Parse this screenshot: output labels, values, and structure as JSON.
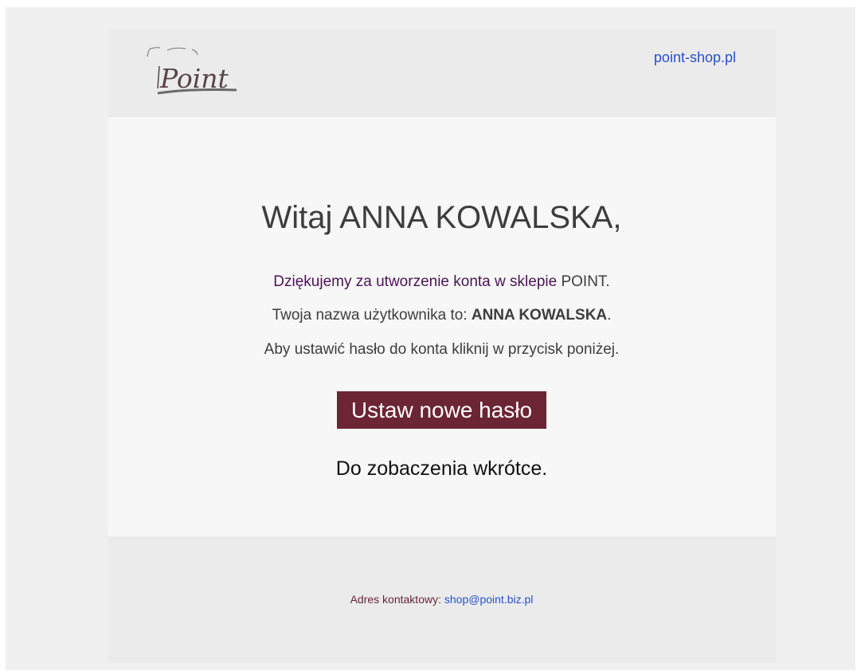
{
  "header": {
    "logo_text": "Point",
    "site_link": "point-shop.pl"
  },
  "main": {
    "greeting": "Witaj ANNA KOWALSKA,",
    "thanks_text": "Dziękujemy za utworzenie konta w sklepie",
    "shop_name": " POINT.",
    "username_prefix": "Twoja nazwa użytkownika to: ",
    "username": "ANNA KOWALSKA",
    "username_suffix": ".",
    "instruction": "Aby ustawić hasło do konta kliknij w przycisk poniżej.",
    "button_label": "Ustaw nowe hasło",
    "closing": "Do zobaczenia wkrótce."
  },
  "footer": {
    "contact_label": "Adres kontaktowy: ",
    "contact_email": "shop@point.biz.pl"
  },
  "colors": {
    "accent": "#6b2535",
    "link": "#2452c9",
    "thanks": "#4b1356"
  }
}
